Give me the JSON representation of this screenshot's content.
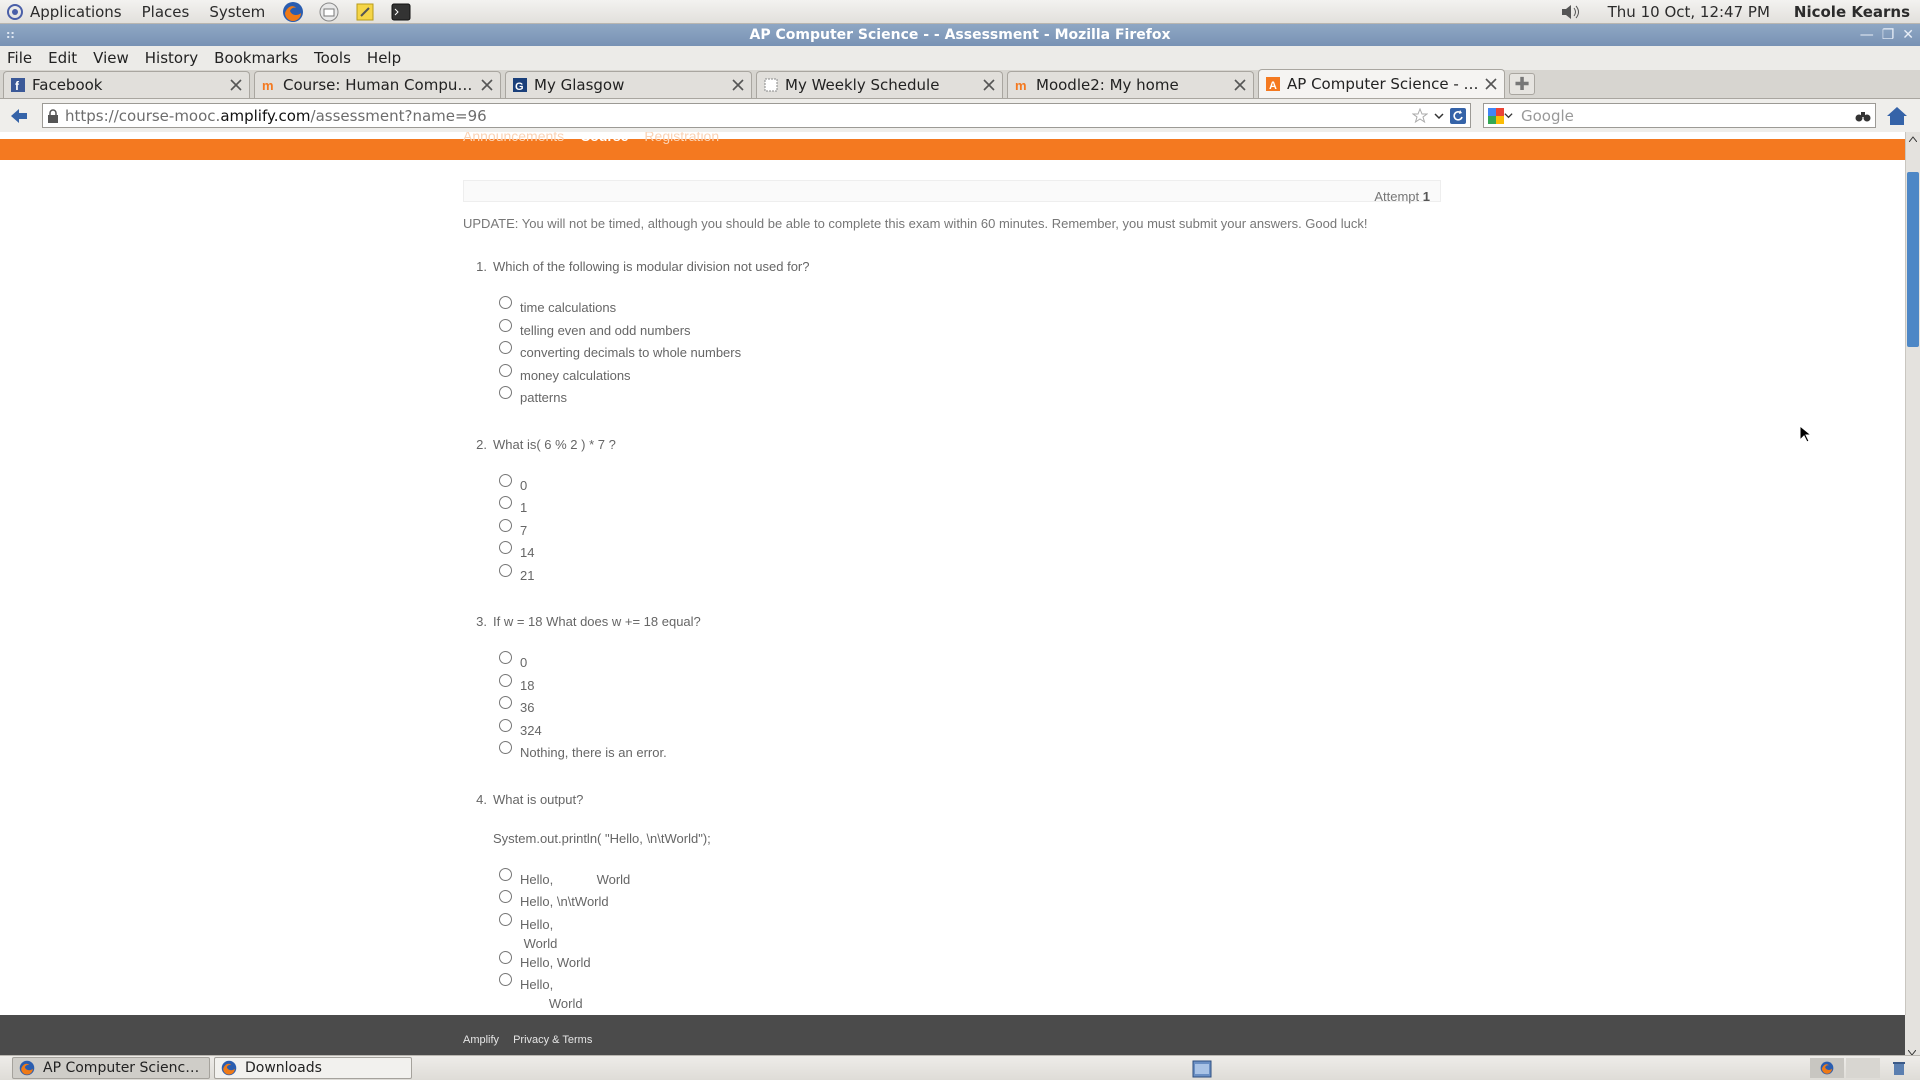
{
  "panel": {
    "menus": [
      "Applications",
      "Places",
      "System"
    ],
    "clock": "Thu 10 Oct, 12:47 PM",
    "user": "Nicole Kearns"
  },
  "window": {
    "title": "AP Computer Science - - Assessment - Mozilla Firefox"
  },
  "menubar": [
    "File",
    "Edit",
    "View",
    "History",
    "Bookmarks",
    "Tools",
    "Help"
  ],
  "tabs": [
    {
      "label": "Facebook",
      "icon": "facebook-icon"
    },
    {
      "label": "Course: Human Computer In...",
      "icon": "moodle-icon"
    },
    {
      "label": "My Glasgow",
      "icon": "glasgow-icon"
    },
    {
      "label": "My Weekly Schedule",
      "icon": "page-icon"
    },
    {
      "label": "Moodle2: My home",
      "icon": "moodle-icon"
    },
    {
      "label": "AP Computer Science - - Ass...",
      "icon": "amplify-icon",
      "active": true
    }
  ],
  "navbar": {
    "url_prefix": "https://course-mooc.",
    "url_host": "amplify.com",
    "url_suffix": "/assessment?name=96",
    "search_placeholder": "Google"
  },
  "site_nav": [
    "Announcements",
    "Course",
    "Registration"
  ],
  "assessment": {
    "attempt_label": "Attempt",
    "attempt_number": "1",
    "update_text": "UPDATE: You will not be timed, although you should be able to complete this exam within 60 minutes. Remember, you must submit your answers. Good luck!",
    "questions": [
      {
        "number": "1.",
        "text": "Which of the following is modular division not used for?",
        "options": [
          "time calculations",
          "telling even and odd numbers",
          "converting decimals to whole numbers",
          "money calculations",
          "patterns"
        ]
      },
      {
        "number": "2.",
        "text": "What is( 6 % 2 ) * 7 ?",
        "options": [
          "0",
          "1",
          "7",
          "14",
          "21"
        ]
      },
      {
        "number": "3.",
        "text": "If w = 18 What does w += 18 equal?",
        "options": [
          "0",
          "18",
          "36",
          "324",
          "Nothing, there is an error."
        ]
      },
      {
        "number": "4.",
        "text": "What is output?",
        "code": "System.out.println( \"Hello, \\n\\tWorld\");",
        "options": [
          "Hello,            World",
          "Hello, \\n\\tWorld",
          "Hello,\n World",
          "Hello, World",
          "Hello,\n        World"
        ]
      }
    ]
  },
  "footer": [
    "Amplify",
    "Privacy & Terms"
  ],
  "taskbar": {
    "tasks": [
      "AP Computer Science -...",
      "Downloads"
    ]
  },
  "colors": {
    "brand_orange": "#f47920",
    "footer_bg": "#4b4b4b",
    "titlebar": "#8fa7c4",
    "scroll_thumb": "#4d87c6"
  }
}
